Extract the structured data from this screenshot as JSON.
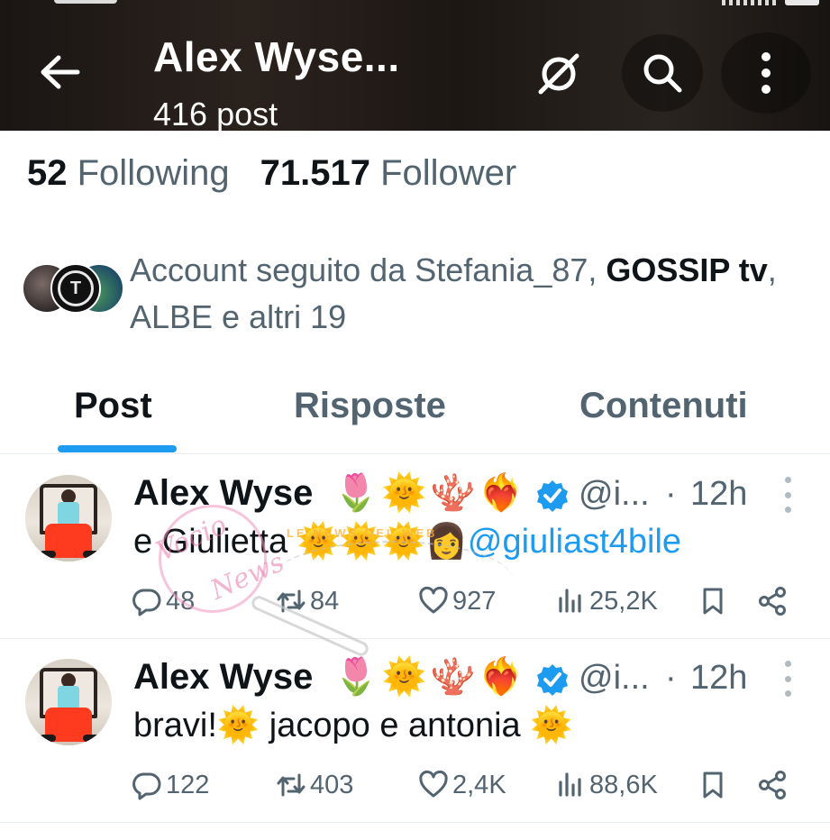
{
  "header": {
    "title": "Alex Wyse...",
    "subtitle": "416 post",
    "icons": [
      "back-arrow-icon",
      "grok-icon",
      "search-icon",
      "more-vertical-icon"
    ]
  },
  "stats": {
    "following_count": "52",
    "following_label": "Following",
    "followers_count": "71.517",
    "followers_label": "Follower"
  },
  "followed_by": {
    "prefix": "Account seguito da Stefania_87, ",
    "bold_name": "GOSSIP tv",
    "suffix": ", ALBE e altri 19"
  },
  "tabs": [
    {
      "label": "Post",
      "active": true
    },
    {
      "label": "Risposte",
      "active": false
    },
    {
      "label": "Contenuti",
      "active": false
    }
  ],
  "tweets": [
    {
      "name": "Alex Wyse",
      "emojis": "🌷🌞🪸❤️‍🔥",
      "handle": "@i...",
      "separator": "·",
      "time": "12h",
      "text_prefix": "e Giulietta 🌞🌞🌞👩",
      "mention": "@giuliast4bile",
      "text_suffix": "",
      "replies": "48",
      "retweets": "84",
      "likes": "927",
      "views": "25,2K"
    },
    {
      "name": "Alex Wyse",
      "emojis": "🌷🌞🪸❤️‍🔥",
      "handle": "@i...",
      "separator": "·",
      "time": "12h",
      "text_prefix": "bravi!🌞 jacopo e antonia 🌞",
      "mention": "",
      "text_suffix": "",
      "replies": "122",
      "retweets": "403",
      "likes": "2,4K",
      "views": "88,6K"
    }
  ],
  "watermark": {
    "line1": "Vocio",
    "line2": "News",
    "small": "LE NEWS DEL WEB"
  },
  "colors": {
    "accent": "#1d9bf0",
    "text_primary": "#0f1419",
    "text_secondary": "#536471",
    "divider": "#e6ecf0"
  }
}
